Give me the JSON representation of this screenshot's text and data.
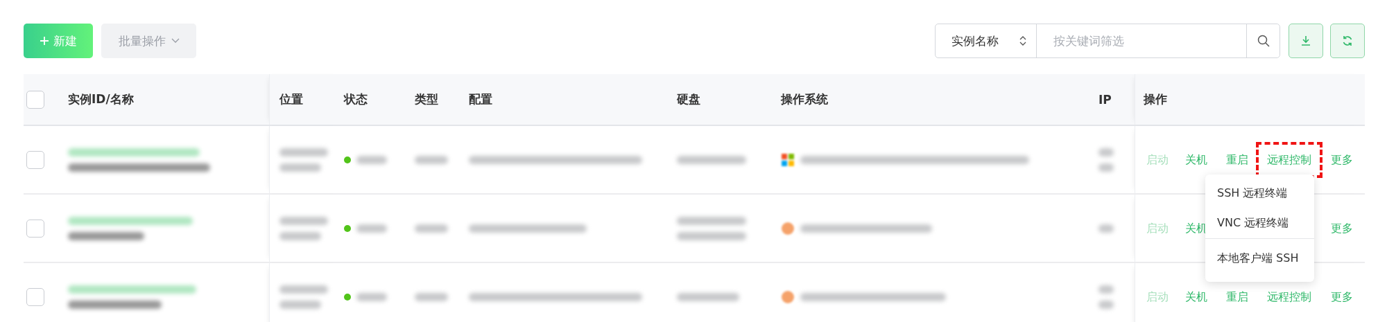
{
  "toolbar": {
    "new_button": "新建",
    "batch_button": "批量操作",
    "search_field_select": "实例名称",
    "search": {
      "placeholder": "按关键词筛选"
    }
  },
  "table": {
    "header_checkbox": {
      "checked": false
    },
    "columns": [
      "实例ID/名称",
      "位置",
      "状态",
      "类型",
      "配置",
      "硬盘",
      "操作系统",
      "IP",
      "操作"
    ],
    "rows": [
      {
        "checked": false,
        "actions": [
          {
            "kind": "start",
            "label": "启动",
            "disabled": true,
            "highlighted": false
          },
          {
            "kind": "stop",
            "label": "关机",
            "disabled": false,
            "highlighted": false
          },
          {
            "kind": "restart",
            "label": "重启",
            "disabled": false,
            "highlighted": false
          },
          {
            "kind": "remote",
            "label": "远程控制",
            "disabled": false,
            "highlighted": true
          },
          {
            "kind": "more",
            "label": "更多",
            "disabled": false,
            "highlighted": false
          }
        ]
      },
      {
        "checked": false,
        "actions": [
          {
            "kind": "start",
            "label": "启动",
            "disabled": true,
            "highlighted": false
          },
          {
            "kind": "stop",
            "label": "关机",
            "disabled": false,
            "highlighted": false
          },
          {
            "kind": "more",
            "label": "更多",
            "disabled": false,
            "highlighted": false
          }
        ]
      },
      {
        "checked": false,
        "actions": [
          {
            "kind": "start",
            "label": "启动",
            "disabled": true,
            "highlighted": false
          },
          {
            "kind": "stop",
            "label": "关机",
            "disabled": false,
            "highlighted": false
          },
          {
            "kind": "restart",
            "label": "重启",
            "disabled": false,
            "highlighted": false
          },
          {
            "kind": "remote",
            "label": "远程控制",
            "disabled": false,
            "highlighted": false
          },
          {
            "kind": "more",
            "label": "更多",
            "disabled": false,
            "highlighted": false
          }
        ]
      }
    ]
  },
  "dropdown_menu": {
    "items": [
      {
        "label": "SSH 远程终端",
        "divider_before": false
      },
      {
        "label": "VNC 远程终端",
        "divider_before": false
      },
      {
        "label": "本地客户端 SSH",
        "divider_before": true
      }
    ]
  }
}
